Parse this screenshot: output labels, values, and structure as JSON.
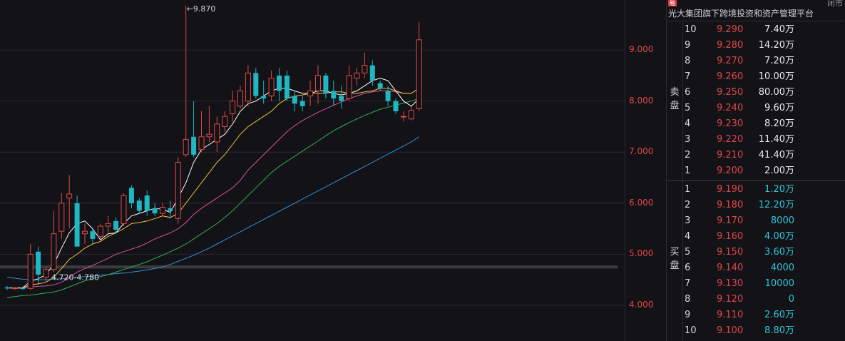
{
  "panel": {
    "badge": "融",
    "close_label": "闭市",
    "title": "光大集团旗下跨境投资和资产管理平台",
    "sell_label": "卖盘",
    "buy_label": "买盘",
    "asks": [
      {
        "level": "10",
        "price": "9.290",
        "volume": "7.40万"
      },
      {
        "level": "9",
        "price": "9.280",
        "volume": "14.20万"
      },
      {
        "level": "8",
        "price": "9.270",
        "volume": "7.20万"
      },
      {
        "level": "7",
        "price": "9.260",
        "volume": "10.00万"
      },
      {
        "level": "6",
        "price": "9.250",
        "volume": "80.00万"
      },
      {
        "level": "5",
        "price": "9.240",
        "volume": "9.60万"
      },
      {
        "level": "4",
        "price": "9.230",
        "volume": "8.20万"
      },
      {
        "level": "3",
        "price": "9.220",
        "volume": "11.40万"
      },
      {
        "level": "2",
        "price": "9.210",
        "volume": "41.40万"
      },
      {
        "level": "1",
        "price": "9.200",
        "volume": "2.00万"
      }
    ],
    "bids": [
      {
        "level": "1",
        "price": "9.190",
        "volume": "1.20万"
      },
      {
        "level": "2",
        "price": "9.180",
        "volume": "12.20万"
      },
      {
        "level": "3",
        "price": "9.170",
        "volume": "8000"
      },
      {
        "level": "4",
        "price": "9.160",
        "volume": "4.00万"
      },
      {
        "level": "5",
        "price": "9.150",
        "volume": "3.60万"
      },
      {
        "level": "6",
        "price": "9.140",
        "volume": "4000"
      },
      {
        "level": "7",
        "price": "9.130",
        "volume": "10000"
      },
      {
        "level": "8",
        "price": "9.120",
        "volume": "0"
      },
      {
        "level": "9",
        "price": "9.110",
        "volume": "2.60万"
      },
      {
        "level": "10",
        "price": "9.100",
        "volume": "8.80万"
      }
    ]
  },
  "chart_data": {
    "type": "candlestick",
    "y_ticks": [
      "9.000",
      "8.000",
      "7.000",
      "6.000",
      "5.000",
      "4.000"
    ],
    "ylim": [
      3.3,
      9.98
    ],
    "grid": true,
    "colors": {
      "up": "#e04848",
      "down": "#1fb7c1",
      "ma5": "#ffffff",
      "ma10": "#f0c040",
      "ma20": "#e0509a",
      "ma30": "#30b050",
      "ma60": "#2f8fd8"
    },
    "annotations": {
      "high_label": "←9.870",
      "high_value": 9.87,
      "zone_label": "4.720-4.780",
      "zone_low": 4.72,
      "zone_high": 4.78
    },
    "candles": [
      {
        "o": 4.35,
        "h": 4.38,
        "l": 4.3,
        "c": 4.33
      },
      {
        "o": 4.33,
        "h": 4.36,
        "l": 4.3,
        "c": 4.34
      },
      {
        "o": 4.34,
        "h": 4.37,
        "l": 4.3,
        "c": 4.32
      },
      {
        "o": 4.33,
        "h": 5.2,
        "l": 4.3,
        "c": 5.0
      },
      {
        "o": 5.05,
        "h": 5.15,
        "l": 4.4,
        "c": 4.6
      },
      {
        "o": 4.55,
        "h": 4.75,
        "l": 4.45,
        "c": 4.7
      },
      {
        "o": 4.7,
        "h": 5.85,
        "l": 4.65,
        "c": 5.4
      },
      {
        "o": 5.45,
        "h": 6.2,
        "l": 5.3,
        "c": 6.0
      },
      {
        "o": 6.1,
        "h": 6.55,
        "l": 5.5,
        "c": 6.18
      },
      {
        "o": 6.0,
        "h": 6.15,
        "l": 5.15,
        "c": 5.15
      },
      {
        "o": 5.4,
        "h": 5.6,
        "l": 5.2,
        "c": 5.45
      },
      {
        "o": 5.45,
        "h": 5.5,
        "l": 5.2,
        "c": 5.3
      },
      {
        "o": 5.35,
        "h": 5.6,
        "l": 5.3,
        "c": 5.55
      },
      {
        "o": 5.55,
        "h": 5.75,
        "l": 5.4,
        "c": 5.6
      },
      {
        "o": 5.65,
        "h": 5.72,
        "l": 5.4,
        "c": 5.48
      },
      {
        "o": 5.6,
        "h": 6.2,
        "l": 5.55,
        "c": 6.15
      },
      {
        "o": 6.3,
        "h": 6.35,
        "l": 5.9,
        "c": 6.0
      },
      {
        "o": 6.05,
        "h": 6.1,
        "l": 5.8,
        "c": 5.85
      },
      {
        "o": 6.15,
        "h": 6.25,
        "l": 5.75,
        "c": 5.85
      },
      {
        "o": 5.9,
        "h": 6.0,
        "l": 5.75,
        "c": 5.8
      },
      {
        "o": 5.8,
        "h": 6.0,
        "l": 5.75,
        "c": 5.92
      },
      {
        "o": 5.9,
        "h": 6.05,
        "l": 5.7,
        "c": 5.85
      },
      {
        "o": 5.7,
        "h": 6.9,
        "l": 5.6,
        "c": 6.8
      },
      {
        "o": 6.95,
        "h": 9.87,
        "l": 6.9,
        "c": 7.25
      },
      {
        "o": 7.3,
        "h": 8.0,
        "l": 6.9,
        "c": 6.95
      },
      {
        "o": 7.05,
        "h": 7.8,
        "l": 7.0,
        "c": 7.3
      },
      {
        "o": 7.3,
        "h": 7.9,
        "l": 7.2,
        "c": 7.35
      },
      {
        "o": 7.2,
        "h": 7.7,
        "l": 7.0,
        "c": 7.55
      },
      {
        "o": 7.5,
        "h": 7.8,
        "l": 7.4,
        "c": 7.7
      },
      {
        "o": 7.75,
        "h": 8.2,
        "l": 7.6,
        "c": 8.0
      },
      {
        "o": 7.9,
        "h": 8.3,
        "l": 7.85,
        "c": 8.2
      },
      {
        "o": 8.0,
        "h": 8.7,
        "l": 7.9,
        "c": 8.55
      },
      {
        "o": 8.55,
        "h": 8.65,
        "l": 8.05,
        "c": 8.1
      },
      {
        "o": 8.1,
        "h": 8.4,
        "l": 7.95,
        "c": 8.05
      },
      {
        "o": 8.1,
        "h": 8.6,
        "l": 8.0,
        "c": 8.45
      },
      {
        "o": 8.5,
        "h": 8.65,
        "l": 8.0,
        "c": 8.2
      },
      {
        "o": 8.5,
        "h": 8.6,
        "l": 8.0,
        "c": 8.05
      },
      {
        "o": 8.1,
        "h": 8.2,
        "l": 7.8,
        "c": 7.95
      },
      {
        "o": 8.0,
        "h": 8.1,
        "l": 7.8,
        "c": 7.9
      },
      {
        "o": 8.1,
        "h": 8.4,
        "l": 7.9,
        "c": 8.2
      },
      {
        "o": 8.2,
        "h": 8.7,
        "l": 7.95,
        "c": 8.5
      },
      {
        "o": 8.5,
        "h": 8.55,
        "l": 8.05,
        "c": 8.15
      },
      {
        "o": 8.2,
        "h": 8.4,
        "l": 7.9,
        "c": 8.05
      },
      {
        "o": 8.1,
        "h": 8.3,
        "l": 7.85,
        "c": 8.0
      },
      {
        "o": 8.05,
        "h": 8.7,
        "l": 8.0,
        "c": 8.5
      },
      {
        "o": 8.45,
        "h": 8.65,
        "l": 8.3,
        "c": 8.55
      },
      {
        "o": 8.55,
        "h": 8.95,
        "l": 8.45,
        "c": 8.7
      },
      {
        "o": 8.7,
        "h": 8.8,
        "l": 8.3,
        "c": 8.4
      },
      {
        "o": 8.35,
        "h": 8.4,
        "l": 8.2,
        "c": 8.25
      },
      {
        "o": 8.2,
        "h": 8.3,
        "l": 7.9,
        "c": 8.0
      },
      {
        "o": 8.0,
        "h": 8.05,
        "l": 7.75,
        "c": 7.8
      },
      {
        "o": 7.7,
        "h": 7.8,
        "l": 7.6,
        "c": 7.7
      },
      {
        "o": 7.65,
        "h": 7.9,
        "l": 7.62,
        "c": 7.82
      },
      {
        "o": 7.85,
        "h": 9.55,
        "l": 7.8,
        "c": 9.2
      }
    ],
    "ma5": [
      4.34,
      4.34,
      4.34,
      4.47,
      4.52,
      4.6,
      4.8,
      5.12,
      5.42,
      5.6,
      5.65,
      5.5,
      5.28,
      5.4,
      5.42,
      5.6,
      5.75,
      5.8,
      5.85,
      5.9,
      5.88,
      5.82,
      6.1,
      6.4,
      6.8,
      7.05,
      7.15,
      7.25,
      7.35,
      7.55,
      7.8,
      7.95,
      8.0,
      8.1,
      8.2,
      8.25,
      8.25,
      8.2,
      8.15,
      8.15,
      8.2,
      8.2,
      8.15,
      8.12,
      8.15,
      8.2,
      8.3,
      8.4,
      8.45,
      8.4,
      8.2,
      8.0,
      7.9,
      8.05
    ],
    "ma10": [
      4.34,
      4.34,
      4.34,
      4.4,
      4.42,
      4.45,
      4.55,
      4.72,
      4.9,
      5.0,
      5.12,
      5.2,
      5.25,
      5.35,
      5.42,
      5.5,
      5.6,
      5.62,
      5.65,
      5.7,
      5.75,
      5.72,
      5.8,
      6.0,
      6.2,
      6.4,
      6.6,
      6.8,
      6.95,
      7.15,
      7.35,
      7.5,
      7.6,
      7.7,
      7.8,
      7.95,
      8.05,
      8.1,
      8.12,
      8.15,
      8.15,
      8.15,
      8.18,
      8.18,
      8.15,
      8.15,
      8.18,
      8.2,
      8.25,
      8.25,
      8.2,
      8.15,
      8.15,
      8.25
    ],
    "ma20": [
      4.34,
      4.34,
      4.34,
      4.36,
      4.37,
      4.38,
      4.4,
      4.45,
      4.55,
      4.65,
      4.72,
      4.78,
      4.85,
      4.92,
      5.0,
      5.05,
      5.1,
      5.15,
      5.22,
      5.3,
      5.36,
      5.42,
      5.5,
      5.62,
      5.78,
      5.9,
      6.0,
      6.1,
      6.2,
      6.3,
      6.45,
      6.65,
      6.8,
      6.95,
      7.1,
      7.25,
      7.4,
      7.52,
      7.62,
      7.7,
      7.78,
      7.85,
      7.92,
      7.98,
      8.05,
      8.1,
      8.15,
      8.18,
      8.2,
      8.2,
      8.18,
      8.15,
      8.15,
      8.25
    ],
    "ma30": [
      4.15,
      4.17,
      4.19,
      4.2,
      4.22,
      4.24,
      4.26,
      4.3,
      4.36,
      4.42,
      4.48,
      4.52,
      4.56,
      4.6,
      4.65,
      4.7,
      4.75,
      4.8,
      4.85,
      4.92,
      4.98,
      5.05,
      5.12,
      5.2,
      5.3,
      5.4,
      5.5,
      5.6,
      5.72,
      5.85,
      6.0,
      6.15,
      6.3,
      6.45,
      6.6,
      6.72,
      6.82,
      6.92,
      7.02,
      7.12,
      7.22,
      7.32,
      7.42,
      7.5,
      7.58,
      7.65,
      7.72,
      7.78,
      7.84,
      7.88,
      7.92,
      7.96,
      8.0,
      8.05
    ],
    "ma60": [
      4.55,
      4.53,
      4.51,
      4.5,
      4.5,
      4.5,
      4.51,
      4.52,
      4.53,
      4.55,
      4.56,
      4.57,
      4.59,
      4.6,
      4.62,
      4.63,
      4.65,
      4.67,
      4.69,
      4.72,
      4.75,
      4.8,
      4.86,
      4.92,
      4.98,
      5.05,
      5.12,
      5.2,
      5.28,
      5.36,
      5.44,
      5.52,
      5.6,
      5.68,
      5.76,
      5.84,
      5.92,
      6.0,
      6.08,
      6.16,
      6.24,
      6.32,
      6.4,
      6.48,
      6.56,
      6.64,
      6.72,
      6.8,
      6.88,
      6.96,
      7.04,
      7.12,
      7.2,
      7.3
    ]
  }
}
